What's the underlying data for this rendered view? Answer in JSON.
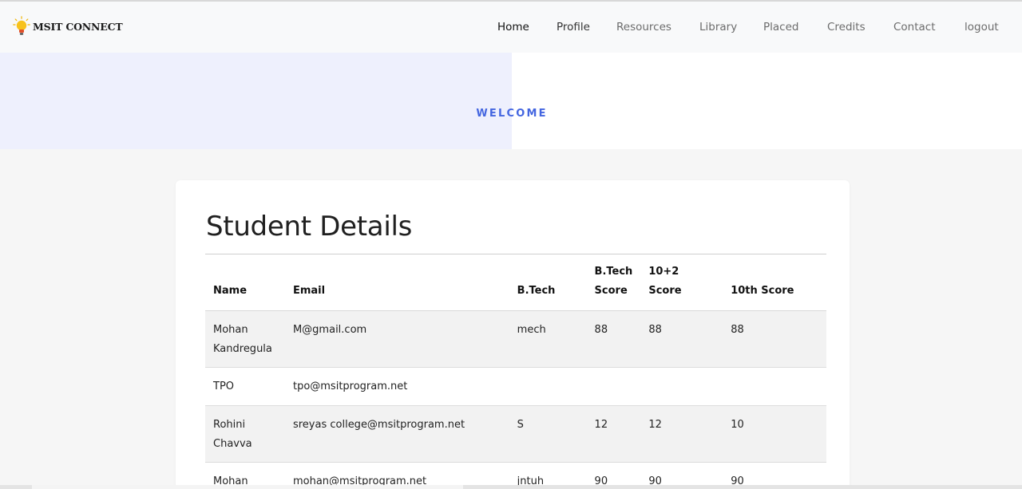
{
  "brand": {
    "name": "MSIT CONNECT",
    "logo_icon": "lightbulb-icon",
    "colors": {
      "bulb": "#f7c21b",
      "base": "#e2502a"
    }
  },
  "nav": {
    "items": [
      {
        "label": "Home"
      },
      {
        "label": "Profile"
      },
      {
        "label": "Resources"
      },
      {
        "label": "Library"
      },
      {
        "label": "Placed"
      },
      {
        "label": "Credits"
      },
      {
        "label": "Contact"
      },
      {
        "label": "logout"
      }
    ],
    "active": "Home"
  },
  "banner": {
    "text": "WELCOME",
    "accent": "#4466e0",
    "tint": "#eef0fd"
  },
  "student_details": {
    "title": "Student Details",
    "columns": {
      "name": "Name",
      "email": "Email",
      "branch": "B.Tech",
      "btech_score_line1": "B.Tech",
      "btech_score_line2": "Score",
      "twelfth": "10+2 Score",
      "tenth": "10th Score"
    },
    "rows": [
      {
        "name_first": "Mohan",
        "name_last": "Kandregula",
        "email": "M@gmail.com",
        "branch": "mech",
        "btech": "88",
        "twelfth": "88",
        "tenth": "88"
      },
      {
        "name_first": "TPO",
        "name_last": "",
        "email": "tpo@msitprogram.net",
        "branch": "",
        "btech": "",
        "twelfth": "",
        "tenth": ""
      },
      {
        "name_first": "Rohini",
        "name_last": "Chavva",
        "email": "sreyas college@msitprogram.net",
        "branch": "S",
        "btech": "12",
        "twelfth": "12",
        "tenth": "10"
      },
      {
        "name_first": "Mohan",
        "name_last": "",
        "email": "mohan@msitprogram.net",
        "branch": "jntuh",
        "btech": "90",
        "twelfth": "90",
        "tenth": "90"
      }
    ]
  }
}
